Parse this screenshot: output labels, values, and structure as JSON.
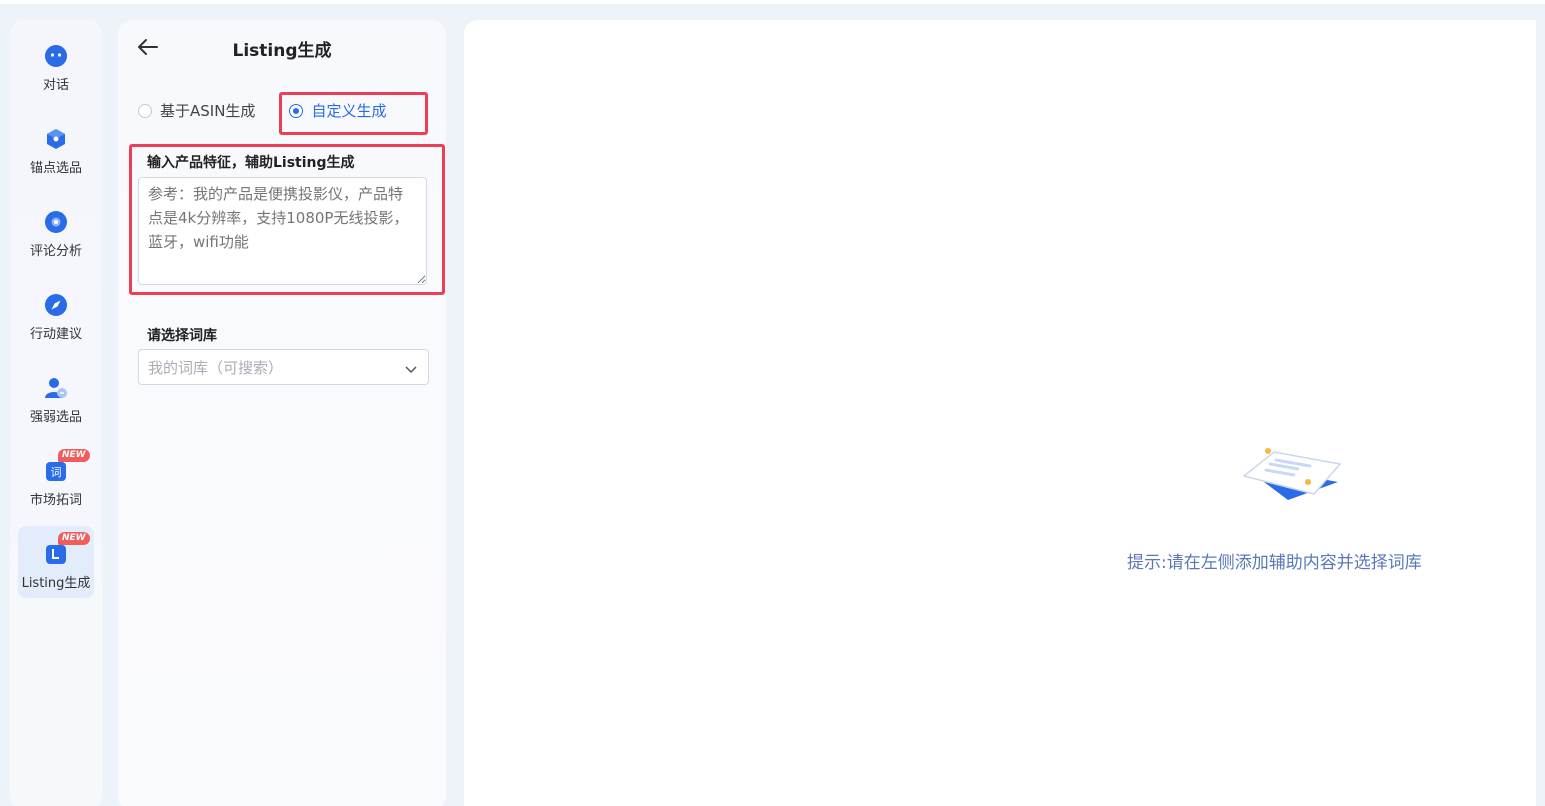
{
  "sidebar": {
    "items": [
      {
        "label": "对话",
        "icon": "chat-bubble-icon",
        "active": false,
        "badge": ""
      },
      {
        "label": "锚点选品",
        "icon": "cube-icon",
        "active": false,
        "badge": ""
      },
      {
        "label": "评论分析",
        "icon": "review-analysis-icon",
        "active": false,
        "badge": ""
      },
      {
        "label": "行动建议",
        "icon": "compass-icon",
        "active": false,
        "badge": ""
      },
      {
        "label": "强弱选品",
        "icon": "user-compare-icon",
        "active": false,
        "badge": ""
      },
      {
        "label": "市场拓词",
        "icon": "word-expansion-icon",
        "active": false,
        "badge": "NEW"
      },
      {
        "label": "Listing生成",
        "icon": "listing-icon",
        "active": true,
        "badge": "NEW"
      }
    ]
  },
  "panel": {
    "title": "Listing生成",
    "mode_options": [
      {
        "label": "基于ASIN生成",
        "checked": false
      },
      {
        "label": "自定义生成",
        "checked": true
      }
    ],
    "feature_label": "输入产品特征，辅助Listing生成",
    "feature_placeholder": "参考：我的产品是便携投影仪，产品特点是4k分辨率，支持1080P无线投影，蓝牙，wifi功能",
    "lexicon_label": "请选择词库",
    "lexicon_placeholder": "我的词库（可搜索）"
  },
  "main": {
    "empty_hint": "提示:请在左侧添加辅助内容并选择词库"
  },
  "colors": {
    "accent": "#2a6be8",
    "highlight": "#ee3d54",
    "badge": "#f25c5c",
    "hint": "#5a78b8"
  }
}
